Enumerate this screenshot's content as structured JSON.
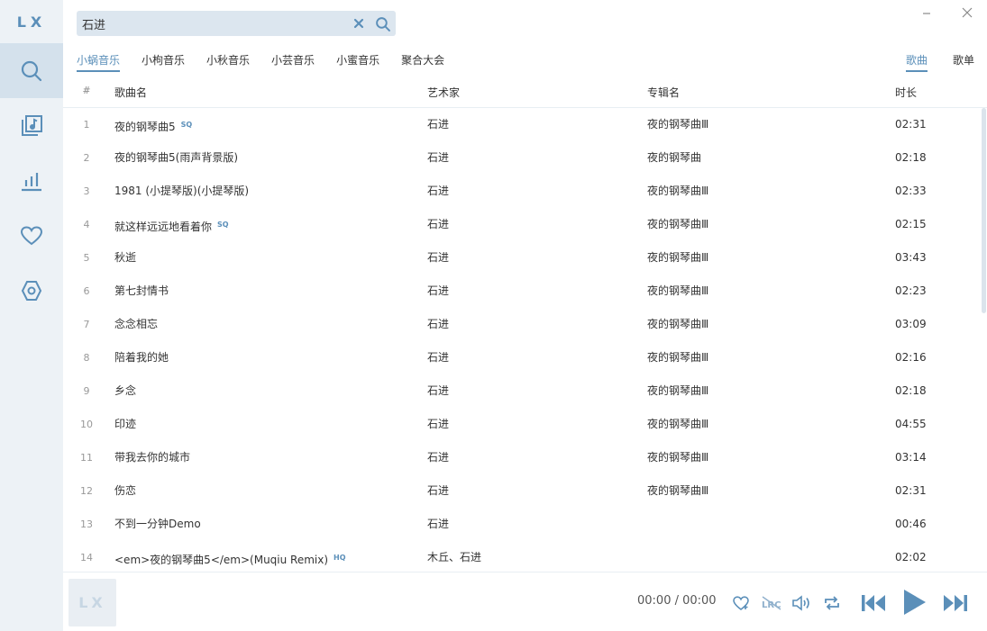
{
  "app": {
    "logo": "LX"
  },
  "sidebar": {
    "items": [
      {
        "name": "search",
        "icon": "search-icon",
        "active": true
      },
      {
        "name": "song-list",
        "icon": "music-list-icon",
        "active": false
      },
      {
        "name": "leaderboard",
        "icon": "bar-chart-icon",
        "active": false
      },
      {
        "name": "favorites",
        "icon": "heart-icon",
        "active": false
      },
      {
        "name": "settings",
        "icon": "hexagon-gear-icon",
        "active": false
      }
    ]
  },
  "search": {
    "value": "石进",
    "placeholder": ""
  },
  "source_tabs": [
    {
      "label": "小蜗音乐",
      "active": true
    },
    {
      "label": "小枸音乐",
      "active": false
    },
    {
      "label": "小秋音乐",
      "active": false
    },
    {
      "label": "小芸音乐",
      "active": false
    },
    {
      "label": "小蜜音乐",
      "active": false
    },
    {
      "label": "聚合大会",
      "active": false
    }
  ],
  "type_tabs": [
    {
      "label": "歌曲",
      "active": true
    },
    {
      "label": "歌单",
      "active": false
    }
  ],
  "table": {
    "headers": {
      "num": "#",
      "name": "歌曲名",
      "artist": "艺术家",
      "album": "专辑名",
      "duration": "时长"
    },
    "rows": [
      {
        "num": "1",
        "name": "夜的钢琴曲5",
        "badge": "SQ",
        "artist": "石进",
        "album": "夜的钢琴曲Ⅲ",
        "duration": "02:31"
      },
      {
        "num": "2",
        "name": "夜的钢琴曲5(雨声背景版)",
        "badge": "",
        "artist": "石进",
        "album": "夜的钢琴曲",
        "duration": "02:18"
      },
      {
        "num": "3",
        "name": "1981 (小提琴版)(小提琴版)",
        "badge": "",
        "artist": "石进",
        "album": "夜的钢琴曲Ⅲ",
        "duration": "02:33"
      },
      {
        "num": "4",
        "name": "就这样远远地看着你",
        "badge": "SQ",
        "artist": "石进",
        "album": "夜的钢琴曲Ⅲ",
        "duration": "02:15"
      },
      {
        "num": "5",
        "name": "秋逝",
        "badge": "",
        "artist": "石进",
        "album": "夜的钢琴曲Ⅲ",
        "duration": "03:43"
      },
      {
        "num": "6",
        "name": "第七封情书",
        "badge": "",
        "artist": "石进",
        "album": "夜的钢琴曲Ⅲ",
        "duration": "02:23"
      },
      {
        "num": "7",
        "name": "念念相忘",
        "badge": "",
        "artist": "石进",
        "album": "夜的钢琴曲Ⅲ",
        "duration": "03:09"
      },
      {
        "num": "8",
        "name": "陪着我的她",
        "badge": "",
        "artist": "石进",
        "album": "夜的钢琴曲Ⅲ",
        "duration": "02:16"
      },
      {
        "num": "9",
        "name": "乡念",
        "badge": "",
        "artist": "石进",
        "album": "夜的钢琴曲Ⅲ",
        "duration": "02:18"
      },
      {
        "num": "10",
        "name": "印迹",
        "badge": "",
        "artist": "石进",
        "album": "夜的钢琴曲Ⅲ",
        "duration": "04:55"
      },
      {
        "num": "11",
        "name": "带我去你的城市",
        "badge": "",
        "artist": "石进",
        "album": "夜的钢琴曲Ⅲ",
        "duration": "03:14"
      },
      {
        "num": "12",
        "name": "伤恋",
        "badge": "",
        "artist": "石进",
        "album": "夜的钢琴曲Ⅲ",
        "duration": "02:31"
      },
      {
        "num": "13",
        "name": "不到一分钟Demo",
        "badge": "",
        "artist": "石进",
        "album": "",
        "duration": "00:46"
      },
      {
        "num": "14",
        "name": "<em>夜的钢琴曲5</em>(Muqiu Remix)",
        "badge": "HQ",
        "artist": "木丘、石进",
        "album": "",
        "duration": "02:02"
      }
    ]
  },
  "player": {
    "cover_text": "LX",
    "time": "00:00 / 00:00",
    "lrc_label": "LRC"
  },
  "colors": {
    "accent": "#5b8fb9",
    "sidebar_bg": "#edf2f6",
    "active_bg": "#d4e1ec",
    "search_bg": "#dce6ef"
  }
}
